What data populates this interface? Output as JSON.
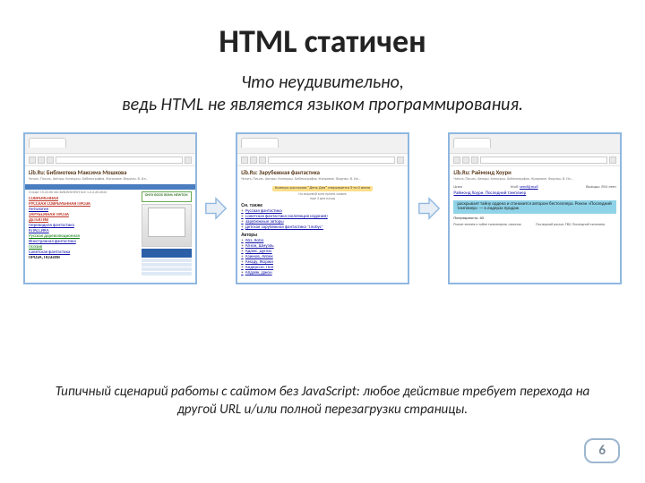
{
  "title": "HTML статичен",
  "subtitle_line1": "Что неудивительно,",
  "subtitle_line2": "ведь HTML не является языком программирования.",
  "footer": "Типичный сценарий работы с сайтом без JavaScript: любое действие требует перехода на другой URL и/или полной перезагрузки страницы.",
  "page_number": "6",
  "screenshots": {
    "s1": {
      "header": "Lib.Ru: Библиотека Максима Мошкова",
      "onyx": "ONYX BOOX I63ML NEWTON",
      "cat_proza": "ПРОЗА, ПОЭЗИЯ",
      "links": [
        "СОВРЕМЕННАЯ",
        "РУССКАЯ СОВРЕМЕННАЯ ПРОЗА",
        "Антология",
        "ЗАРУБЕЖНАЯ ПРОЗА",
        "ДЕТЕКТИВ",
        "Переводная фантастика",
        "КЛАССИКА",
        "Русская дореволюционная",
        "Иностранная фантастика",
        "Поэзия",
        "Советская фантастика"
      ]
    },
    "s2": {
      "header": "Lib.Ru: Зарубежная фантастика",
      "badge": "Конкурс рассказов \"День Дня\" открывается  5-го 0 июня",
      "sect_smtakzhe": "См. также",
      "sect_avtory": "Авторы",
      "items": [
        "Русская фантастика",
        "Советская фантастика (коллекция изданий)",
        "Зарубежные авторы",
        "Детская зарубежная фантастика \"Глобус\""
      ],
      "authors": [
        "Абэ, Кобо",
        "Агнон, Шмуэль",
        "Адамс, Дуглас",
        "Азимов, Айзек",
        "Амаду, Жоржи",
        "Андерсон, Пол",
        "Апдайк, Джон"
      ]
    },
    "s3": {
      "header": "Lib.Ru: Раймонд Хоури",
      "subhdr": "Раймонд Хоури. Последний тамплиер",
      "label_series": "Цикл",
      "label_pop": "Популярность: 40",
      "highlight": "раскрывает тайну ордена и становится автором бестселлера. Роман «Последний тамплиер» — в лидерах продаж",
      "col1": "Роман-эпопея о тайне тамплиеров, начиная",
      "col2": "Последний роман, FB2, Последний тамплиер",
      "label_mail": "Mail:",
      "label_site": "Выходы: RSS-лент"
    }
  }
}
